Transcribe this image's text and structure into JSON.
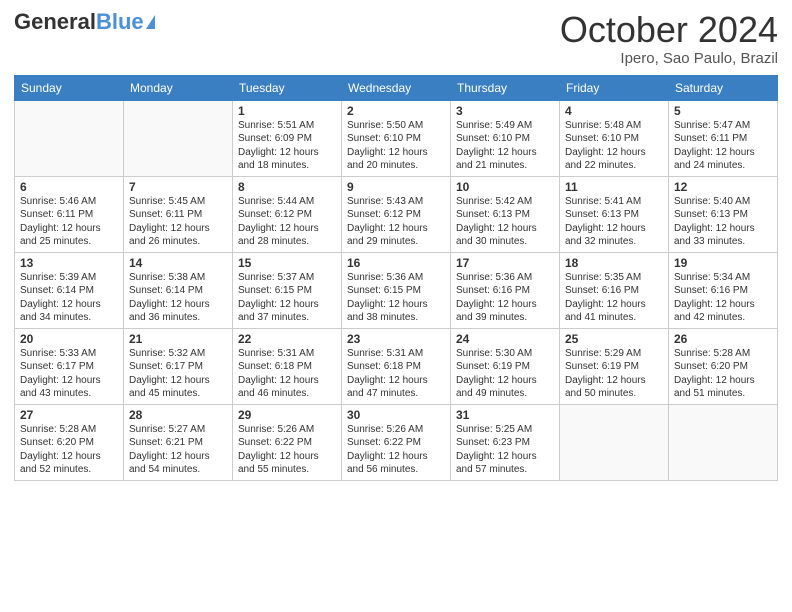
{
  "header": {
    "logo_general": "General",
    "logo_blue": "Blue",
    "month_title": "October 2024",
    "location": "Ipero, Sao Paulo, Brazil"
  },
  "days_of_week": [
    "Sunday",
    "Monday",
    "Tuesday",
    "Wednesday",
    "Thursday",
    "Friday",
    "Saturday"
  ],
  "weeks": [
    [
      {
        "day": "",
        "content": ""
      },
      {
        "day": "",
        "content": ""
      },
      {
        "day": "1",
        "content": "Sunrise: 5:51 AM\nSunset: 6:09 PM\nDaylight: 12 hours and 18 minutes."
      },
      {
        "day": "2",
        "content": "Sunrise: 5:50 AM\nSunset: 6:10 PM\nDaylight: 12 hours and 20 minutes."
      },
      {
        "day": "3",
        "content": "Sunrise: 5:49 AM\nSunset: 6:10 PM\nDaylight: 12 hours and 21 minutes."
      },
      {
        "day": "4",
        "content": "Sunrise: 5:48 AM\nSunset: 6:10 PM\nDaylight: 12 hours and 22 minutes."
      },
      {
        "day": "5",
        "content": "Sunrise: 5:47 AM\nSunset: 6:11 PM\nDaylight: 12 hours and 24 minutes."
      }
    ],
    [
      {
        "day": "6",
        "content": "Sunrise: 5:46 AM\nSunset: 6:11 PM\nDaylight: 12 hours and 25 minutes."
      },
      {
        "day": "7",
        "content": "Sunrise: 5:45 AM\nSunset: 6:11 PM\nDaylight: 12 hours and 26 minutes."
      },
      {
        "day": "8",
        "content": "Sunrise: 5:44 AM\nSunset: 6:12 PM\nDaylight: 12 hours and 28 minutes."
      },
      {
        "day": "9",
        "content": "Sunrise: 5:43 AM\nSunset: 6:12 PM\nDaylight: 12 hours and 29 minutes."
      },
      {
        "day": "10",
        "content": "Sunrise: 5:42 AM\nSunset: 6:13 PM\nDaylight: 12 hours and 30 minutes."
      },
      {
        "day": "11",
        "content": "Sunrise: 5:41 AM\nSunset: 6:13 PM\nDaylight: 12 hours and 32 minutes."
      },
      {
        "day": "12",
        "content": "Sunrise: 5:40 AM\nSunset: 6:13 PM\nDaylight: 12 hours and 33 minutes."
      }
    ],
    [
      {
        "day": "13",
        "content": "Sunrise: 5:39 AM\nSunset: 6:14 PM\nDaylight: 12 hours and 34 minutes."
      },
      {
        "day": "14",
        "content": "Sunrise: 5:38 AM\nSunset: 6:14 PM\nDaylight: 12 hours and 36 minutes."
      },
      {
        "day": "15",
        "content": "Sunrise: 5:37 AM\nSunset: 6:15 PM\nDaylight: 12 hours and 37 minutes."
      },
      {
        "day": "16",
        "content": "Sunrise: 5:36 AM\nSunset: 6:15 PM\nDaylight: 12 hours and 38 minutes."
      },
      {
        "day": "17",
        "content": "Sunrise: 5:36 AM\nSunset: 6:16 PM\nDaylight: 12 hours and 39 minutes."
      },
      {
        "day": "18",
        "content": "Sunrise: 5:35 AM\nSunset: 6:16 PM\nDaylight: 12 hours and 41 minutes."
      },
      {
        "day": "19",
        "content": "Sunrise: 5:34 AM\nSunset: 6:16 PM\nDaylight: 12 hours and 42 minutes."
      }
    ],
    [
      {
        "day": "20",
        "content": "Sunrise: 5:33 AM\nSunset: 6:17 PM\nDaylight: 12 hours and 43 minutes."
      },
      {
        "day": "21",
        "content": "Sunrise: 5:32 AM\nSunset: 6:17 PM\nDaylight: 12 hours and 45 minutes."
      },
      {
        "day": "22",
        "content": "Sunrise: 5:31 AM\nSunset: 6:18 PM\nDaylight: 12 hours and 46 minutes."
      },
      {
        "day": "23",
        "content": "Sunrise: 5:31 AM\nSunset: 6:18 PM\nDaylight: 12 hours and 47 minutes."
      },
      {
        "day": "24",
        "content": "Sunrise: 5:30 AM\nSunset: 6:19 PM\nDaylight: 12 hours and 49 minutes."
      },
      {
        "day": "25",
        "content": "Sunrise: 5:29 AM\nSunset: 6:19 PM\nDaylight: 12 hours and 50 minutes."
      },
      {
        "day": "26",
        "content": "Sunrise: 5:28 AM\nSunset: 6:20 PM\nDaylight: 12 hours and 51 minutes."
      }
    ],
    [
      {
        "day": "27",
        "content": "Sunrise: 5:28 AM\nSunset: 6:20 PM\nDaylight: 12 hours and 52 minutes."
      },
      {
        "day": "28",
        "content": "Sunrise: 5:27 AM\nSunset: 6:21 PM\nDaylight: 12 hours and 54 minutes."
      },
      {
        "day": "29",
        "content": "Sunrise: 5:26 AM\nSunset: 6:22 PM\nDaylight: 12 hours and 55 minutes."
      },
      {
        "day": "30",
        "content": "Sunrise: 5:26 AM\nSunset: 6:22 PM\nDaylight: 12 hours and 56 minutes."
      },
      {
        "day": "31",
        "content": "Sunrise: 5:25 AM\nSunset: 6:23 PM\nDaylight: 12 hours and 57 minutes."
      },
      {
        "day": "",
        "content": ""
      },
      {
        "day": "",
        "content": ""
      }
    ]
  ]
}
